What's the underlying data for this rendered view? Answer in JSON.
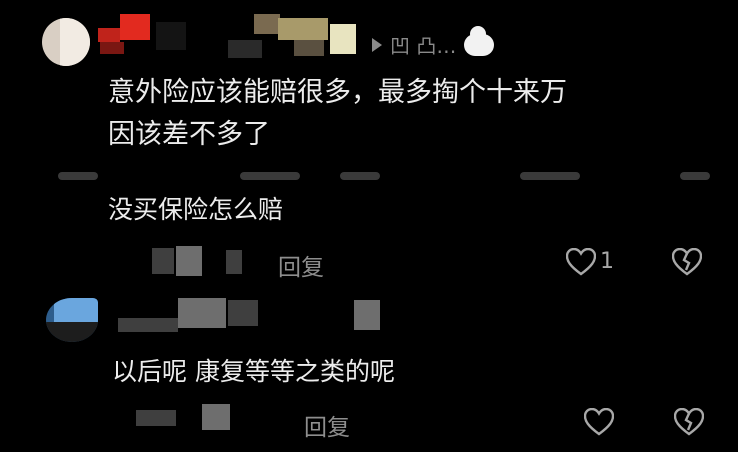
{
  "comment1": {
    "text_line1": "意外险应该能赔很多，最多掏个十来万",
    "text_line2": "因该差不多了",
    "meta_text": "凹 凸…"
  },
  "reply1": {
    "text": "没买保险怎么赔",
    "reply_label": "回复",
    "like_count": "1"
  },
  "reply2": {
    "text": "以后呢 康复等等之类的呢",
    "reply_label": "回复"
  },
  "icons": {
    "play": "play-triangle-icon",
    "cloud": "cloud-icon",
    "like": "heart-icon",
    "dislike": "broken-heart-icon"
  }
}
